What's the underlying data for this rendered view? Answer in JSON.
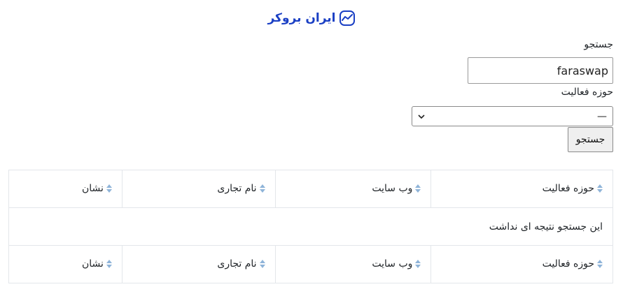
{
  "brand": {
    "name": "ایران بروکر",
    "color": "#1a3fc4",
    "icon": "trend-chart-logo-icon"
  },
  "search": {
    "label": "جستجو",
    "value": "faraswap"
  },
  "activity": {
    "label": "حوزه فعالیت",
    "selected": "—",
    "icon": "chevron-down-icon"
  },
  "submit_label": "جستجو",
  "table": {
    "headers": [
      "حوزه فعالیت",
      "وب سایت",
      "نام تجاری",
      "نشان"
    ],
    "empty_message": "این جستجو نتیجه ای نداشت",
    "footers": [
      "حوزه فعالیت",
      "وب سایت",
      "نام تجاری",
      "نشان"
    ],
    "sort_icon": "sort-arrows-icon",
    "sort_color": "#8fb4d9"
  }
}
